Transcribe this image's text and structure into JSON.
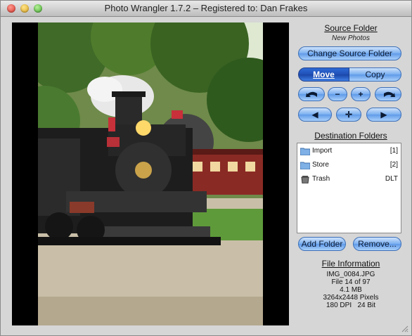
{
  "window": {
    "title": "Photo Wrangler 1.7.2 – Registered to: Dan Frakes"
  },
  "source": {
    "title": "Source Folder",
    "folder": "New Photos",
    "change_label": "Change Source Folder"
  },
  "mode": {
    "move_label": "Move",
    "copy_label": "Copy",
    "selected": "Move"
  },
  "rotate": {
    "minus_label": "−",
    "plus_label": "+"
  },
  "navigation": {
    "prev_label": "◀",
    "center_label": "✛",
    "next_label": "▶"
  },
  "destinations": {
    "title": "Destination Folders",
    "items": [
      {
        "name": "Import",
        "tag": "[1]",
        "icon": "folder-icon"
      },
      {
        "name": "Store",
        "tag": "[2]",
        "icon": "folder-icon"
      },
      {
        "name": "Trash",
        "tag": "DLT",
        "icon": "trash-icon"
      }
    ],
    "add_label": "Add Folder",
    "remove_label": "Remove..."
  },
  "file_info": {
    "title": "File Information",
    "name": "IMG_0084.JPG",
    "position": "File 14 of 97",
    "size": "4.1 MB",
    "pixels": "3264x2448 Pixels",
    "resolution": "180 DPI",
    "bit_depth": "24 Bit"
  },
  "colors": {
    "accent": "#5f9ae8",
    "selected_segment": "#1f4fb5"
  }
}
